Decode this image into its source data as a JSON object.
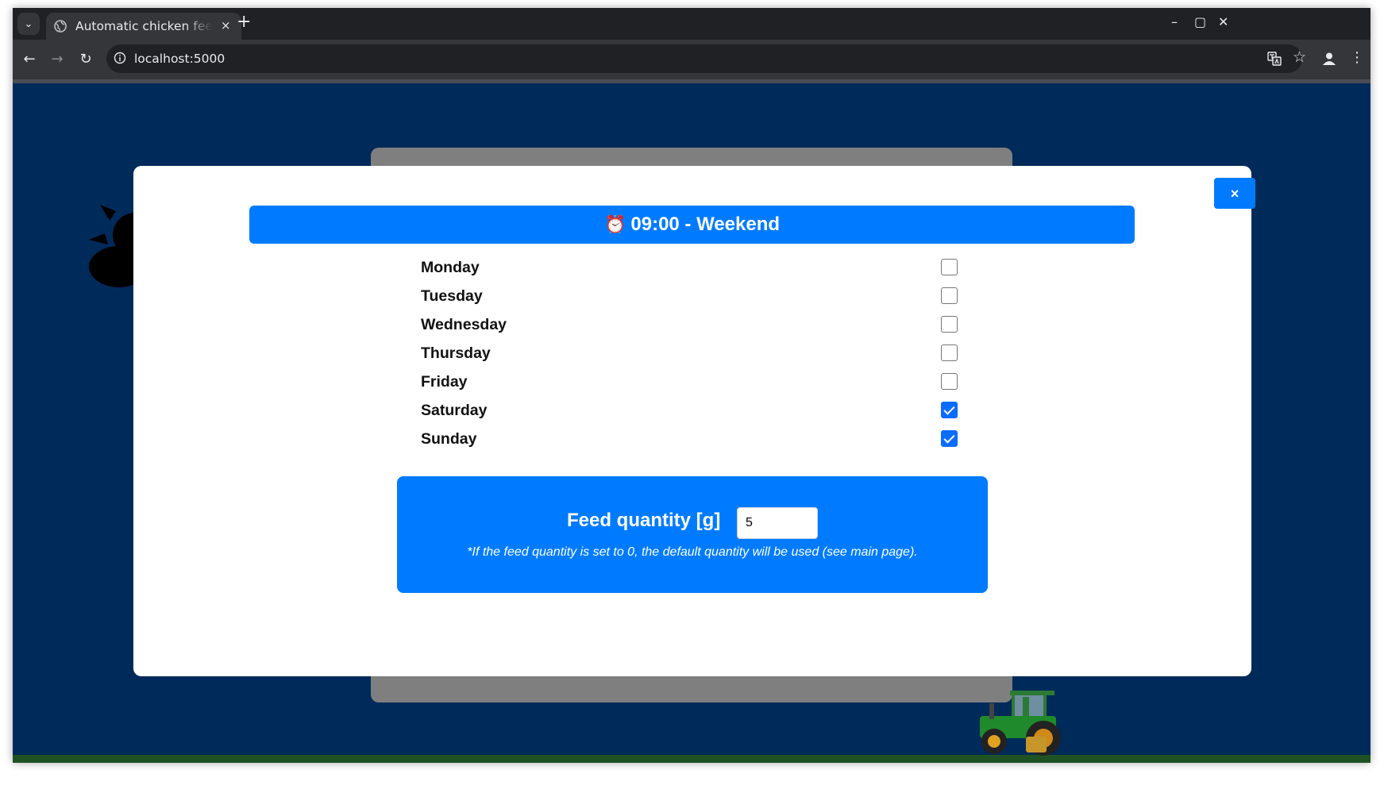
{
  "browser": {
    "tab_title": "Automatic chicken feeder",
    "url": "localhost:5000",
    "tab_close_glyph": "×",
    "new_tab_glyph": "+",
    "window_controls": {
      "minimize": "–",
      "maximize": "▢",
      "close": "✕"
    },
    "nav": {
      "back": "←",
      "forward": "→",
      "reload": "↻",
      "menu": "⋮"
    }
  },
  "modal": {
    "close_label": "×",
    "header_icon": "⏰",
    "header_title": "09:00 - Weekend",
    "days": [
      {
        "label": "Monday",
        "checked": false
      },
      {
        "label": "Tuesday",
        "checked": false
      },
      {
        "label": "Wednesday",
        "checked": false
      },
      {
        "label": "Thursday",
        "checked": false
      },
      {
        "label": "Friday",
        "checked": false
      },
      {
        "label": "Saturday",
        "checked": true
      },
      {
        "label": "Sunday",
        "checked": true
      }
    ],
    "feed": {
      "label": "Feed quantity [g]",
      "value": "5",
      "note": "*If the feed quantity is set to 0, the default quantity will be used (see main page)."
    }
  },
  "colors": {
    "page_background": "#002a5a",
    "accent": "#007bff",
    "ground": "#1f5223",
    "background_card": "#7f7f7f"
  },
  "icons": {
    "tab_favicon": "globe-icon",
    "weather": "sun-cloud-icon",
    "decoration": "tractor-icon",
    "header": "alarm-clock-icon"
  }
}
